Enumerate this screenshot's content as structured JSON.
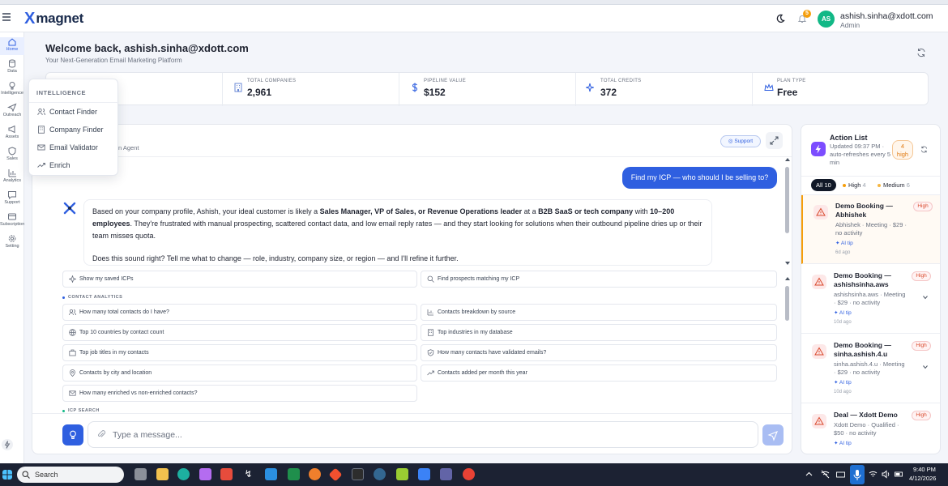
{
  "app": {
    "logo_mark": "X",
    "logo_text": "magnet"
  },
  "header": {
    "notification_count": "5",
    "avatar_initials": "AS",
    "user_email": "ashish.sinha@xdott.com",
    "user_role": "Admin",
    "icons": [
      "menu-icon",
      "moon-icon",
      "bell-icon"
    ]
  },
  "sidebar": {
    "items": [
      {
        "label": "Home",
        "icon": "home-icon",
        "active": true
      },
      {
        "label": "Data",
        "icon": "database-icon"
      },
      {
        "label": "Intelligence",
        "icon": "lightbulb-icon"
      },
      {
        "label": "Outreach",
        "icon": "send-icon"
      },
      {
        "label": "Assets",
        "icon": "megaphone-icon"
      },
      {
        "label": "Sales",
        "icon": "shield-icon"
      },
      {
        "label": "Analytics",
        "icon": "bar-chart-icon"
      },
      {
        "label": "Support",
        "icon": "message-icon"
      },
      {
        "label": "Subscription",
        "icon": "receipt-icon"
      },
      {
        "label": "Setting",
        "icon": "gear-icon"
      }
    ]
  },
  "dashboard": {
    "welcome": "Welcome back, ashish.sinha@xdott.com",
    "tagline": "Your Next-Generation Email Marketing Platform"
  },
  "stats": [
    {
      "label": "TOTAL COMPANIES",
      "value": "2,961",
      "icon": "building-icon"
    },
    {
      "label": "PIPELINE VALUE",
      "value": "$152",
      "icon": "dollar-icon"
    },
    {
      "label": "TOTAL CREDITS",
      "value": "372",
      "icon": "sparkle-icon"
    },
    {
      "label": "PLAN TYPE",
      "value": "Free",
      "icon": "crown-icon"
    }
  ],
  "intelligence_menu": {
    "title": "INTELLIGENCE",
    "items": [
      {
        "label": "Contact Finder",
        "icon": "users-icon"
      },
      {
        "label": "Company Finder",
        "icon": "building-icon"
      },
      {
        "label": "Email Validator",
        "icon": "mail-icon"
      },
      {
        "label": "Enrich",
        "icon": "trend-icon"
      }
    ]
  },
  "chat": {
    "subtitle_visible": "n Agent",
    "support_label": "Support",
    "user_message": "Find my ICP — who should I be selling to?",
    "bot_reply": {
      "p1_a": "Based on your company profile, Ashish, your ideal customer is likely a ",
      "p1_b": "Sales Manager, VP of Sales, or Revenue Operations leader",
      "p1_c": " at a ",
      "p1_d": "B2B SaaS or tech company",
      "p1_e": " with ",
      "p1_f": "10–200 employees",
      "p1_g": ". They're frustrated with manual prospecting, scattered contact data, and low email reply rates — and they start looking for solutions when their outbound pipeline dries up or their team misses quota.",
      "p2": "Does this sound right? Tell me what to change — role, industry, company size, or region — and I'll refine it further."
    },
    "quick_actions": [
      "Show my saved ICPs",
      "Find prospects matching my ICP"
    ],
    "contact_analytics_label": "CONTACT ANALYTICS",
    "suggestions": [
      "How many total contacts do I have?",
      "Contacts breakdown by source",
      "Top 10 countries by contact count",
      "Top industries in my database",
      "Top job titles in my contacts",
      "How many contacts have validated emails?",
      "Contacts by city and location",
      "Contacts added per month this year",
      "How many enriched vs non-enriched contacts?"
    ],
    "icp_search_label": "ICP SEARCH",
    "input_placeholder": "Type a message..."
  },
  "action_list": {
    "title": "Action List",
    "subtitle": "Updated 09:37 PM · auto-refreshes every 5 min",
    "badge_count": "4",
    "badge_label": "high",
    "filters": [
      {
        "label": "All",
        "count": "10",
        "active": true
      },
      {
        "label": "High",
        "count": "4",
        "color": "#f59e0b"
      },
      {
        "label": "Medium",
        "count": "6",
        "color": "#f5b642"
      }
    ],
    "tasks": [
      {
        "title": "Demo Booking — Abhishek",
        "meta": "Abhishek · Meeting · $29 · no activity",
        "tip": "AI tip",
        "age": "6d ago",
        "priority": "High"
      },
      {
        "title": "Demo Booking — ashishsinha.aws",
        "meta": "ashishsinha.aws · Meeting · $29 · no activity",
        "tip": "AI tip",
        "age": "10d ago",
        "priority": "High"
      },
      {
        "title": "Demo Booking — sinha.ashish.4.u",
        "meta": "sinha.ashish.4.u · Meeting · $29 · no activity",
        "tip": "AI tip",
        "age": "10d ago",
        "priority": "High"
      },
      {
        "title": "Deal — Xdott Demo",
        "meta": "Xdott Demo · Qualified · $50 · no activity",
        "tip": "AI tip",
        "age": "",
        "priority": "High"
      }
    ]
  },
  "taskbar": {
    "search_label": "Search",
    "time": "9:40 PM",
    "date": "4/12/2026"
  },
  "colors": {
    "accent": "#2f5fe0",
    "high_priority": "#d9482b",
    "warning": "#f59e0b"
  }
}
